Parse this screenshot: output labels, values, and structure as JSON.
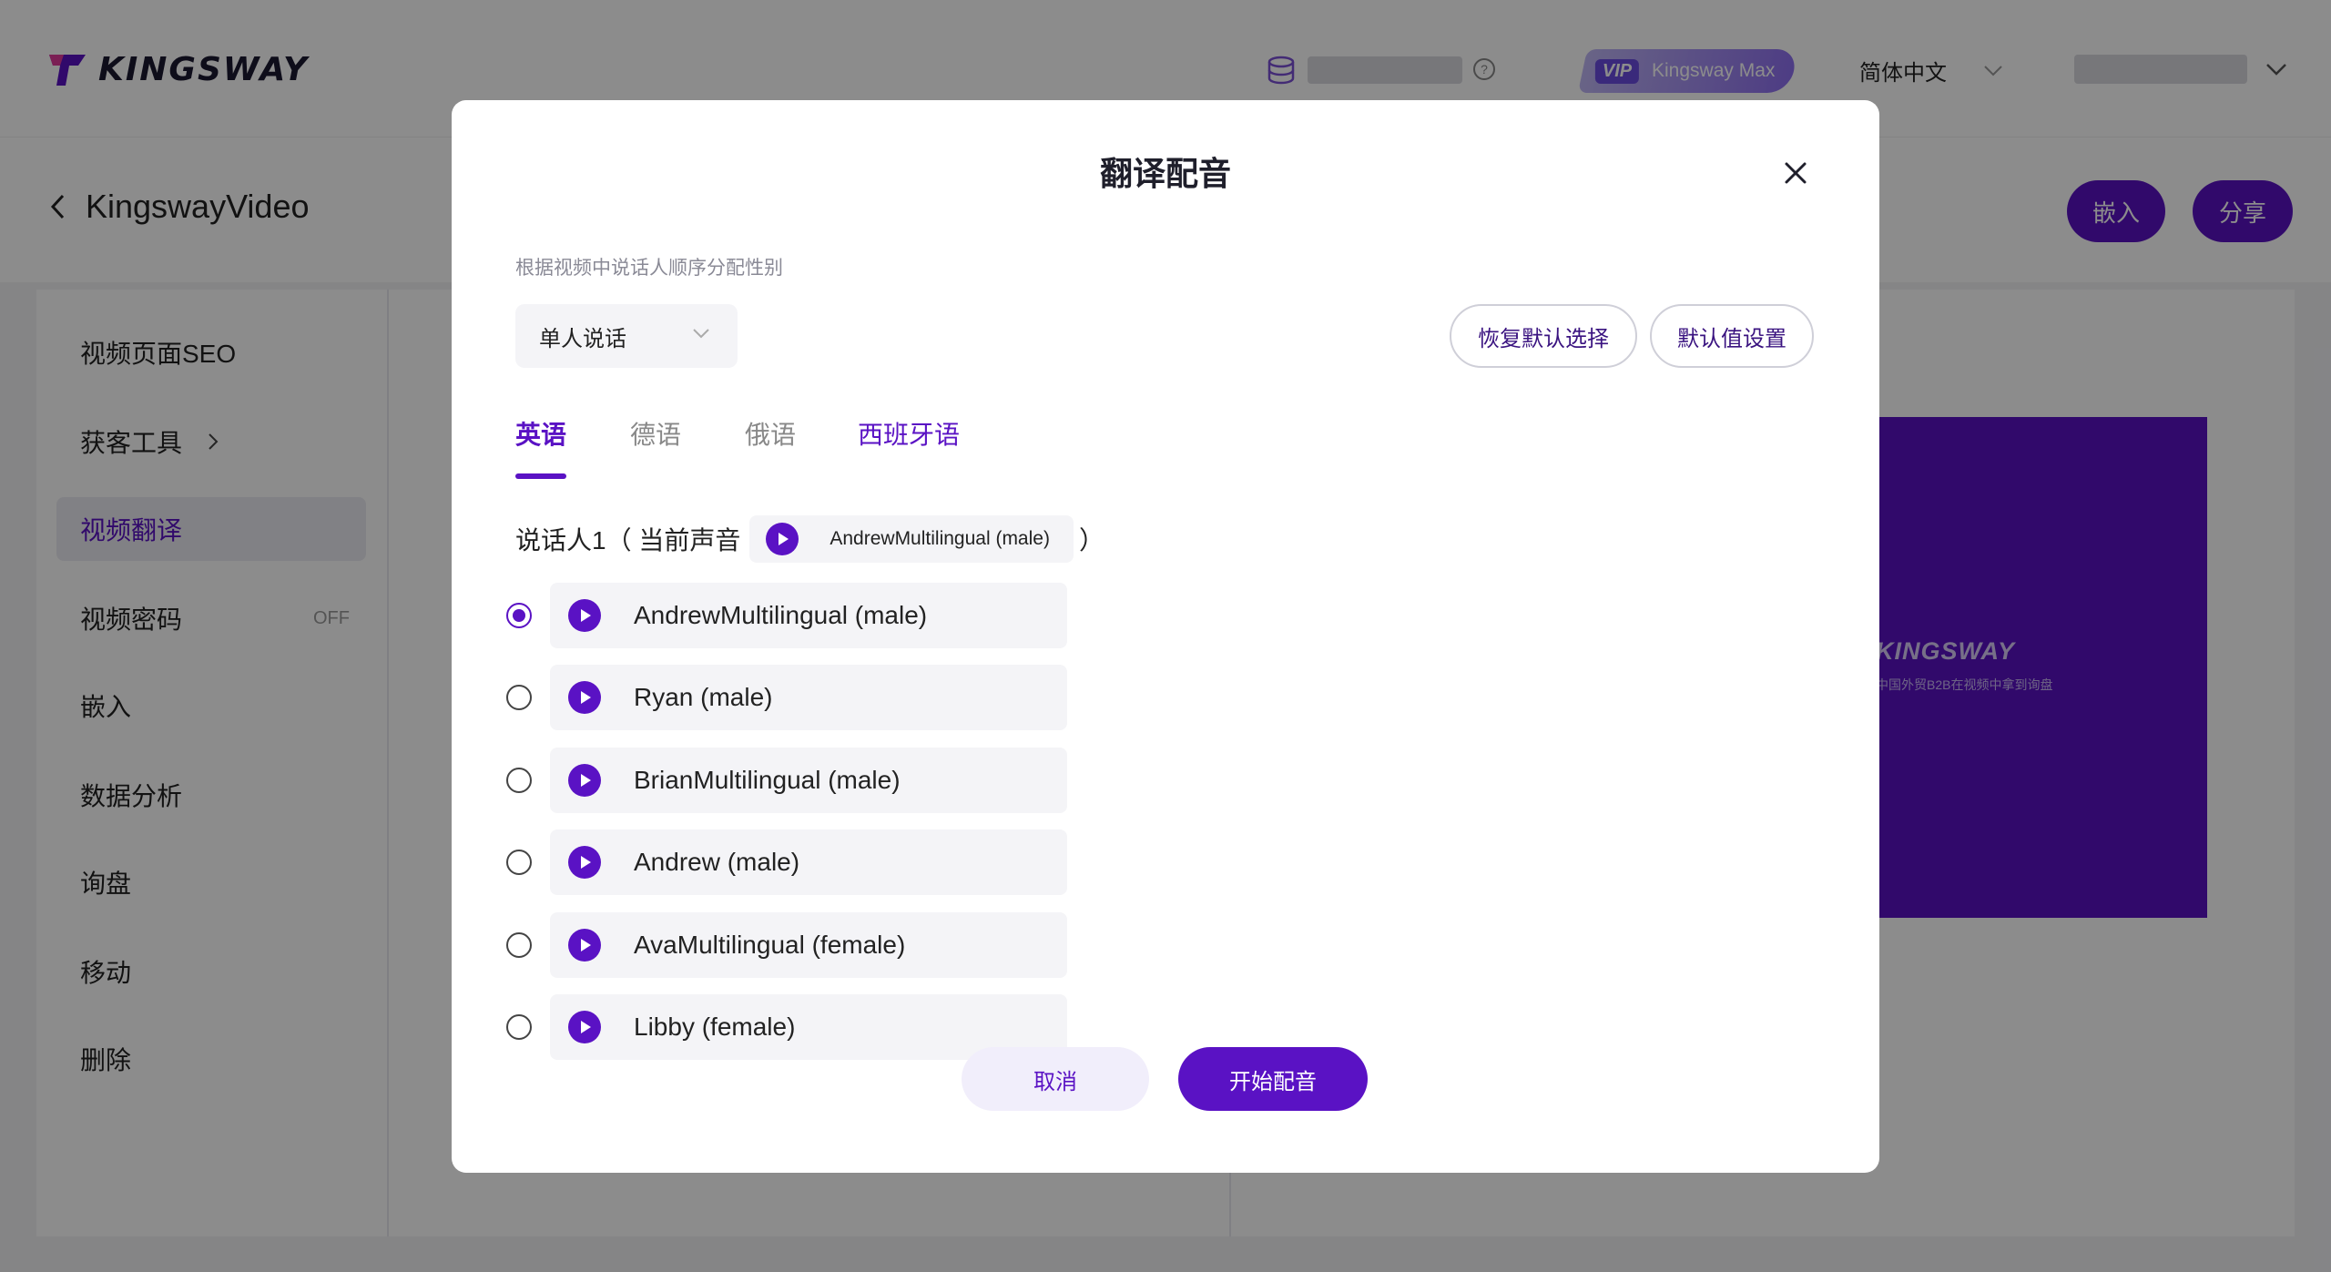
{
  "app": {
    "brand": "KINGSWAY",
    "vip_tag": "VIP",
    "vip_plan": "Kingsway Max",
    "language": "简体中文",
    "back_title": "KingswayVideo",
    "embed_button": "嵌入",
    "share_button": "分享",
    "sidebar": [
      {
        "label": "视频页面SEO"
      },
      {
        "label": "获客工具"
      },
      {
        "label": "视频翻译"
      },
      {
        "label": "视频密码",
        "badge": "OFF"
      },
      {
        "label": "嵌入"
      },
      {
        "label": "数据分析"
      },
      {
        "label": "询盘"
      },
      {
        "label": "移动"
      },
      {
        "label": "删除"
      }
    ],
    "preview_brand": "KINGSWAY",
    "preview_slogan": "中国外贸B2B在视频中拿到询盘"
  },
  "modal": {
    "title": "翻译配音",
    "hint": "根据视频中说话人顺序分配性别",
    "mode": "单人说话",
    "restore_button": "恢复默认选择",
    "defaults_button": "默认值设置",
    "tabs": [
      "英语",
      "德语",
      "俄语",
      "西班牙语"
    ],
    "speaker_prefix": "说话人1（ 当前声音",
    "speaker_suffix": "）",
    "current_voice": "AndrewMultilingual (male)",
    "voices": [
      {
        "name": "AndrewMultilingual (male)",
        "selected": true
      },
      {
        "name": "Ryan (male)",
        "selected": false
      },
      {
        "name": "BrianMultilingual (male)",
        "selected": false
      },
      {
        "name": "Andrew (male)",
        "selected": false
      },
      {
        "name": "AvaMultilingual (female)",
        "selected": false
      },
      {
        "name": "Libby (female)",
        "selected": false
      }
    ],
    "cancel_button": "取消",
    "start_button": "开始配音"
  },
  "colors": {
    "accent": "#5a12c4",
    "overlay": "rgba(0,0,0,0.45)"
  }
}
